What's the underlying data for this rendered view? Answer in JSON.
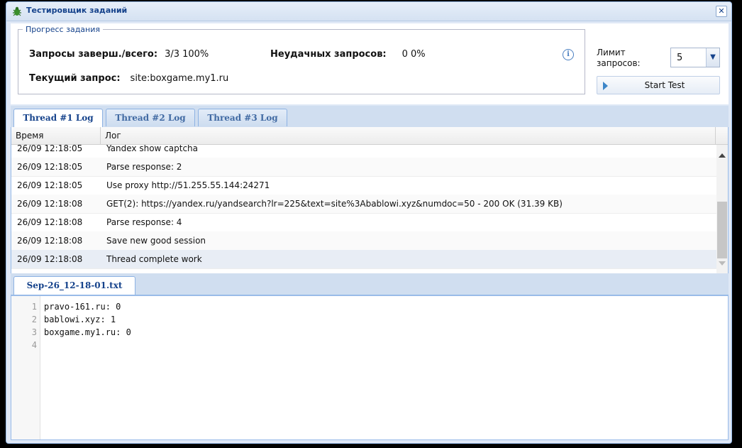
{
  "window": {
    "title": "Тестировщик заданий",
    "close_label": "✕"
  },
  "progress": {
    "legend": "Прогресс задания",
    "done_label": "Запросы заверш./всего:",
    "done_value": "3/3 100%",
    "failed_label": "Неудачных запросов:",
    "failed_value": "0 0%",
    "current_label": "Текущий запрос:",
    "current_value": "site:boxgame.my1.ru"
  },
  "limit": {
    "label_line1": "Лимит",
    "label_line2": "запросов:",
    "value": "5"
  },
  "start_button": {
    "label": "Start Test"
  },
  "thread_tabs": [
    {
      "label": "Thread #1 Log",
      "active": true
    },
    {
      "label": "Thread #2 Log",
      "active": false
    },
    {
      "label": "Thread #3 Log",
      "active": false
    }
  ],
  "log": {
    "col_time": "Время",
    "col_log": "Лог",
    "rows": [
      {
        "time": "26/09 12:18:05",
        "msg": "Yandex show captcha"
      },
      {
        "time": "26/09 12:18:05",
        "msg": "Parse response: 2"
      },
      {
        "time": "26/09 12:18:05",
        "msg": "Use proxy http://51.255.55.144:24271"
      },
      {
        "time": "26/09 12:18:08",
        "msg": "GET(2): https://yandex.ru/yandsearch?lr=225&text=site%3Abablowi.xyz&numdoc=50 - 200 OK (31.39 KB)"
      },
      {
        "time": "26/09 12:18:08",
        "msg": "Parse response: 4"
      },
      {
        "time": "26/09 12:18:08",
        "msg": "Save new good session"
      },
      {
        "time": "26/09 12:18:08",
        "msg": "Thread complete work"
      }
    ]
  },
  "file_tab": {
    "label": "Sep-26_12-18-01.txt"
  },
  "editor": {
    "line_numbers": [
      "1",
      "2",
      "3",
      "4"
    ],
    "lines": [
      "pravo-161.ru: 0",
      "bablowi.xyz: 1",
      "boxgame.my1.ru: 0",
      ""
    ]
  }
}
